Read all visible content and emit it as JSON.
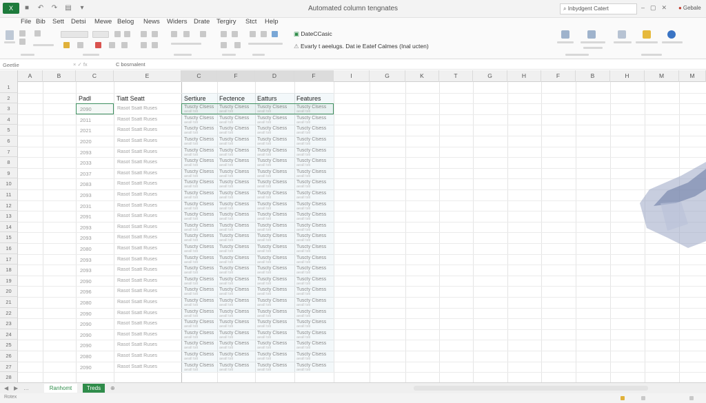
{
  "window": {
    "app_icon": "X",
    "title": "Automated column tengnates",
    "search_text": "Inbydgent Catert",
    "account": "Gebale",
    "icons": [
      "minimize-icon",
      "maximize-icon",
      "close-icon"
    ]
  },
  "menu": [
    "File",
    "Bib",
    "Sett",
    "Detsi",
    "Mewe",
    "Belog",
    "News",
    "Widers",
    "Drate",
    "Tergiry",
    "Stct",
    "Help"
  ],
  "ribbon": {
    "notice_title": "DateCCasic",
    "notice_text": "Evarly t aeelugs. Dat ie Eatef Calmes (Inal ucten)"
  },
  "formula_bar": {
    "name_box": "Geetlie",
    "fx": "×  ✓  fx",
    "value": "C bosrnalent"
  },
  "columns": [
    "A",
    "B",
    "C",
    "E",
    "C",
    "F",
    "D",
    "F",
    "I",
    "G",
    "K",
    "T",
    "G",
    "H",
    "F",
    "B",
    "H",
    "M",
    "M"
  ],
  "rows": [
    "1",
    "2",
    "3",
    "4",
    "5",
    "6",
    "7",
    "8",
    "9",
    "10",
    "11",
    "12",
    "13",
    "14",
    "15",
    "16",
    "17",
    "18",
    "19",
    "20",
    "21",
    "22",
    "23",
    "24",
    "25",
    "26",
    "27",
    "28"
  ],
  "table": {
    "headers": [
      "Padl",
      "Tiatt Seatt",
      "Sertiure",
      "Fectence",
      "Eatturs",
      "Features"
    ],
    "years": [
      "2090",
      "2011",
      "2021",
      "2020",
      "2093",
      "2033",
      "2037",
      "2083",
      "2093",
      "2031",
      "2091",
      "2093",
      "2093",
      "2080",
      "2093",
      "2093",
      "2090",
      "2096",
      "2080",
      "2090",
      "2090",
      "2090",
      "2090",
      "2080",
      "2090"
    ],
    "text_value": "Rasot Ssatt Ruses",
    "data_line1": "Tuscty Clsess",
    "data_line2": "aeall tsti"
  },
  "sheet_tabs": {
    "nav": [
      "◀",
      "▶",
      "…"
    ],
    "sheet1": "Ranhomt",
    "sheet2": "Treds",
    "add": "⊕"
  },
  "status": {
    "text": "Rotex"
  },
  "colors": {
    "brand_green": "#1e7b3c",
    "selection": "#3d8f5f",
    "tab_active": "#2f8c4a"
  }
}
